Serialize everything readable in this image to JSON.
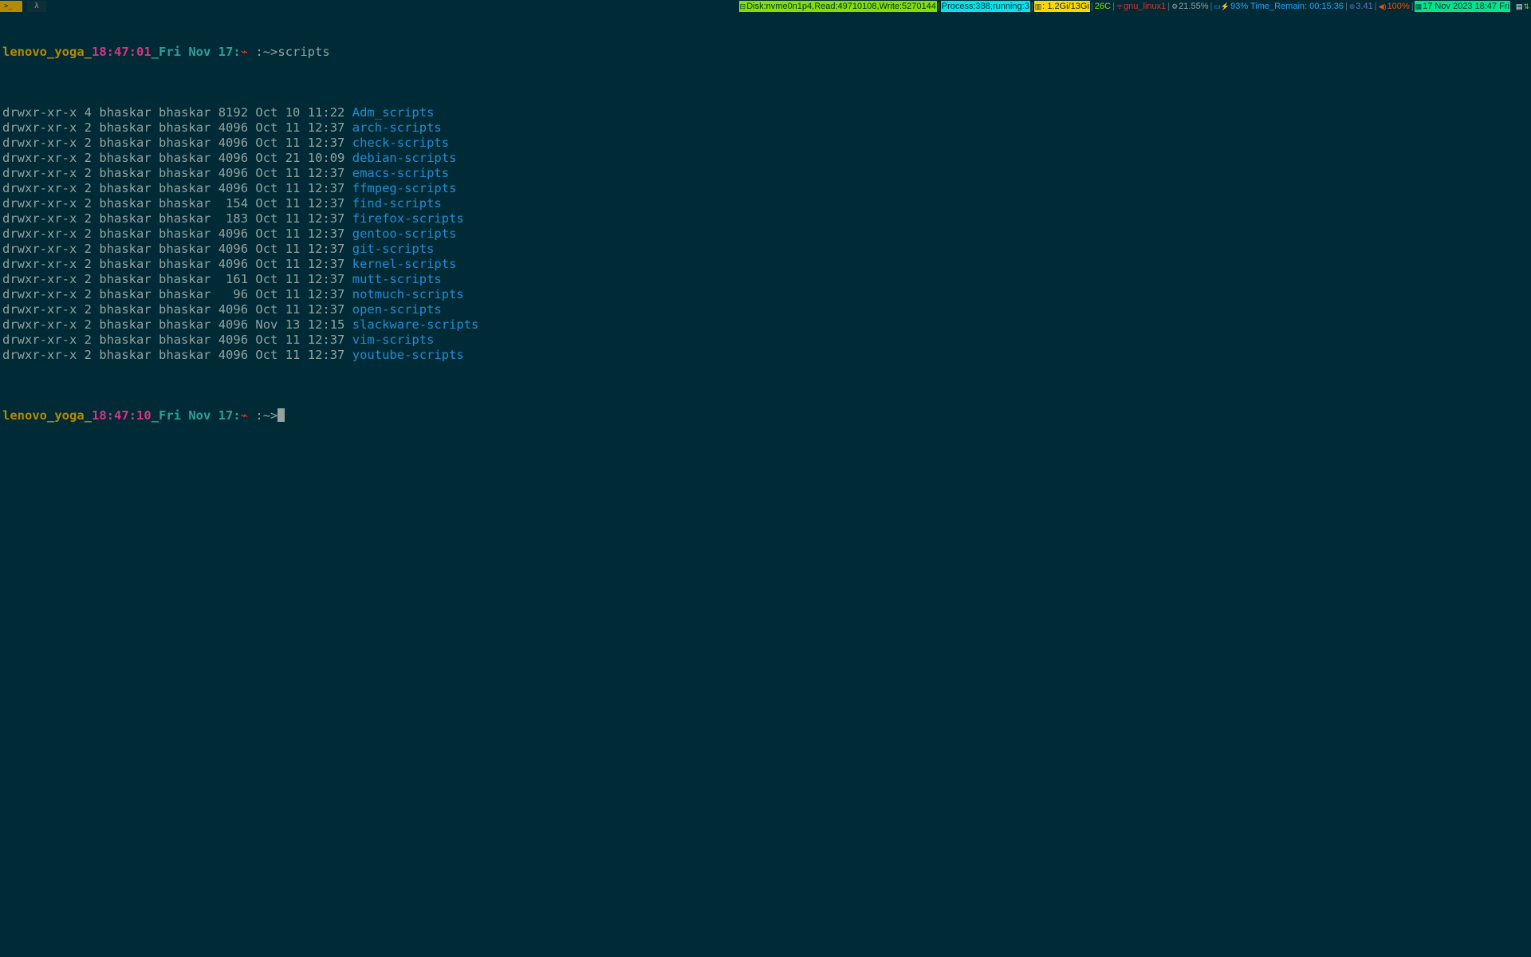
{
  "workspaces": [
    {
      "label": ">_",
      "icon": "terminal-icon",
      "active": true
    },
    {
      "label": "λ",
      "icon": "lambda-icon",
      "active": false
    }
  ],
  "status": {
    "disk": {
      "icon": "disk-icon",
      "text": "Disk:nvme0n1p4,Read:49710108,Write:5270144"
    },
    "process": {
      "text": "Process:388;running:3"
    },
    "memory": {
      "icon": "bar-chart-icon",
      "text": ": 1.2Gi/13Gi"
    },
    "temperature": {
      "text": "26C"
    },
    "network": {
      "icon": "wifi-icon",
      "text": "gnu_linux1"
    },
    "cpu": {
      "icon": "gear-icon",
      "text": "21.55%"
    },
    "battery": {
      "icon": "battery-icon",
      "text": "93% Time_Remain: 00:15:36"
    },
    "load": {
      "icon": "load-icon",
      "text": "3.41"
    },
    "volume": {
      "icon": "speaker-icon",
      "text": "100%"
    },
    "datetime": {
      "icon": "calendar-icon",
      "text": "17 Nov 2023 18:47 Fri"
    },
    "tray": [
      "document-icon",
      "network-tray-icon"
    ]
  },
  "terminal": {
    "prompt1": {
      "host": "lenovo_yoga_",
      "hour": "18",
      "colon1": ":",
      "minute": "47",
      "colon2": ":",
      "second": "01",
      "date": "_Fri Nov 17",
      "colon3": ":",
      "symbol": "⌁",
      "path": " :~>",
      "command": "scripts"
    },
    "listing": [
      {
        "perms": "drwxr-xr-x",
        "links": "4",
        "owner": "bhaskar",
        "group": "bhaskar",
        "size": "8192",
        "month": "Oct",
        "day": "10",
        "time": "11:22",
        "name": "Adm_scripts"
      },
      {
        "perms": "drwxr-xr-x",
        "links": "2",
        "owner": "bhaskar",
        "group": "bhaskar",
        "size": "4096",
        "month": "Oct",
        "day": "11",
        "time": "12:37",
        "name": "arch-scripts"
      },
      {
        "perms": "drwxr-xr-x",
        "links": "2",
        "owner": "bhaskar",
        "group": "bhaskar",
        "size": "4096",
        "month": "Oct",
        "day": "11",
        "time": "12:37",
        "name": "check-scripts"
      },
      {
        "perms": "drwxr-xr-x",
        "links": "2",
        "owner": "bhaskar",
        "group": "bhaskar",
        "size": "4096",
        "month": "Oct",
        "day": "21",
        "time": "10:09",
        "name": "debian-scripts"
      },
      {
        "perms": "drwxr-xr-x",
        "links": "2",
        "owner": "bhaskar",
        "group": "bhaskar",
        "size": "4096",
        "month": "Oct",
        "day": "11",
        "time": "12:37",
        "name": "emacs-scripts"
      },
      {
        "perms": "drwxr-xr-x",
        "links": "2",
        "owner": "bhaskar",
        "group": "bhaskar",
        "size": "4096",
        "month": "Oct",
        "day": "11",
        "time": "12:37",
        "name": "ffmpeg-scripts"
      },
      {
        "perms": "drwxr-xr-x",
        "links": "2",
        "owner": "bhaskar",
        "group": "bhaskar",
        "size": "154",
        "month": "Oct",
        "day": "11",
        "time": "12:37",
        "name": "find-scripts"
      },
      {
        "perms": "drwxr-xr-x",
        "links": "2",
        "owner": "bhaskar",
        "group": "bhaskar",
        "size": "183",
        "month": "Oct",
        "day": "11",
        "time": "12:37",
        "name": "firefox-scripts"
      },
      {
        "perms": "drwxr-xr-x",
        "links": "2",
        "owner": "bhaskar",
        "group": "bhaskar",
        "size": "4096",
        "month": "Oct",
        "day": "11",
        "time": "12:37",
        "name": "gentoo-scripts"
      },
      {
        "perms": "drwxr-xr-x",
        "links": "2",
        "owner": "bhaskar",
        "group": "bhaskar",
        "size": "4096",
        "month": "Oct",
        "day": "11",
        "time": "12:37",
        "name": "git-scripts"
      },
      {
        "perms": "drwxr-xr-x",
        "links": "2",
        "owner": "bhaskar",
        "group": "bhaskar",
        "size": "4096",
        "month": "Oct",
        "day": "11",
        "time": "12:37",
        "name": "kernel-scripts"
      },
      {
        "perms": "drwxr-xr-x",
        "links": "2",
        "owner": "bhaskar",
        "group": "bhaskar",
        "size": "161",
        "month": "Oct",
        "day": "11",
        "time": "12:37",
        "name": "mutt-scripts"
      },
      {
        "perms": "drwxr-xr-x",
        "links": "2",
        "owner": "bhaskar",
        "group": "bhaskar",
        "size": "96",
        "month": "Oct",
        "day": "11",
        "time": "12:37",
        "name": "notmuch-scripts"
      },
      {
        "perms": "drwxr-xr-x",
        "links": "2",
        "owner": "bhaskar",
        "group": "bhaskar",
        "size": "4096",
        "month": "Oct",
        "day": "11",
        "time": "12:37",
        "name": "open-scripts"
      },
      {
        "perms": "drwxr-xr-x",
        "links": "2",
        "owner": "bhaskar",
        "group": "bhaskar",
        "size": "4096",
        "month": "Nov",
        "day": "13",
        "time": "12:15",
        "name": "slackware-scripts"
      },
      {
        "perms": "drwxr-xr-x",
        "links": "2",
        "owner": "bhaskar",
        "group": "bhaskar",
        "size": "4096",
        "month": "Oct",
        "day": "11",
        "time": "12:37",
        "name": "vim-scripts"
      },
      {
        "perms": "drwxr-xr-x",
        "links": "2",
        "owner": "bhaskar",
        "group": "bhaskar",
        "size": "4096",
        "month": "Oct",
        "day": "11",
        "time": "12:37",
        "name": "youtube-scripts"
      }
    ],
    "prompt2": {
      "host": "lenovo_yoga_",
      "hour": "18",
      "colon1": ":",
      "minute": "47",
      "colon2": ":",
      "second": "10",
      "date": "_Fri Nov 17",
      "colon3": ":",
      "symbol": "⌁",
      "path": " :~>",
      "command": ""
    }
  },
  "colors": {
    "background": "#002b36",
    "foreground": "#93a1a1",
    "host": "#b58900",
    "time": "#d33682",
    "date": "#2aa198",
    "directory": "#268bd2",
    "prompt_symbol": "#dc322f"
  }
}
